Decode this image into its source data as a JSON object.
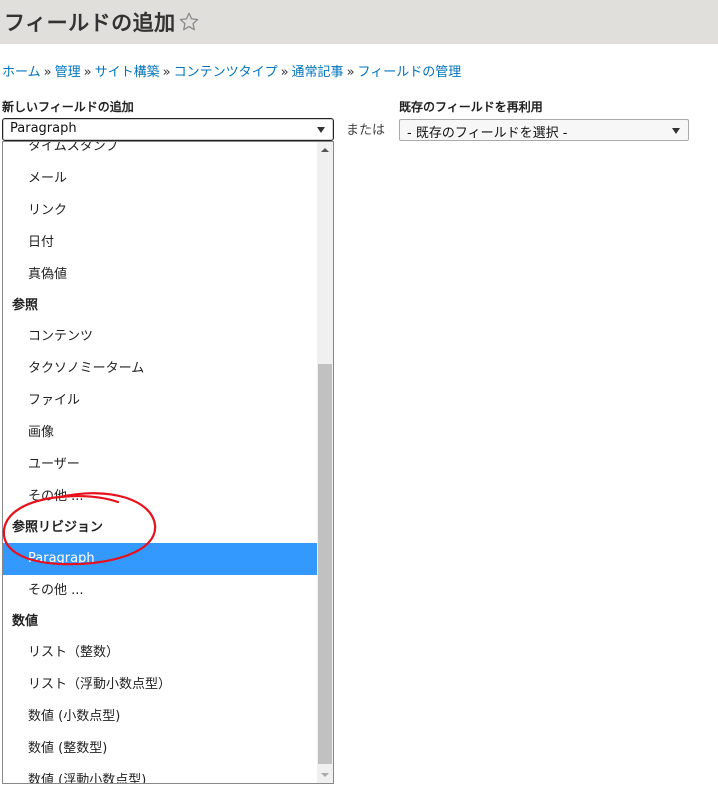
{
  "header": {
    "title": "フィールドの追加",
    "star_icon": "star-outline-icon"
  },
  "breadcrumb": {
    "items": [
      "ホーム",
      "管理",
      "サイト構築",
      "コンテンツタイプ",
      "通常記事",
      "フィールドの管理"
    ],
    "separator": "»"
  },
  "new_field": {
    "label": "新しいフィールドの追加",
    "selected_value": "Paragraph"
  },
  "or_text": "または",
  "existing_field": {
    "label": "既存のフィールドを再利用",
    "selected_value": "- 既存のフィールドを選択 -"
  },
  "dropdown": {
    "items": [
      {
        "type": "option",
        "label": "タイムスタンプ"
      },
      {
        "type": "option",
        "label": "メール"
      },
      {
        "type": "option",
        "label": "リンク"
      },
      {
        "type": "option",
        "label": "日付"
      },
      {
        "type": "option",
        "label": "真偽値"
      },
      {
        "type": "group",
        "label": "参照"
      },
      {
        "type": "option",
        "label": "コンテンツ"
      },
      {
        "type": "option",
        "label": "タクソノミーターム"
      },
      {
        "type": "option",
        "label": "ファイル"
      },
      {
        "type": "option",
        "label": "画像"
      },
      {
        "type": "option",
        "label": "ユーザー"
      },
      {
        "type": "option",
        "label": "その他 ..."
      },
      {
        "type": "group",
        "label": "参照リビジョン"
      },
      {
        "type": "option",
        "label": "Paragraph",
        "selected": true
      },
      {
        "type": "option",
        "label": "その他 ..."
      },
      {
        "type": "group",
        "label": "数値"
      },
      {
        "type": "option",
        "label": "リスト（整数）"
      },
      {
        "type": "option",
        "label": "リスト（浮動小数点型）"
      },
      {
        "type": "option",
        "label": "数値 (小数点型)"
      },
      {
        "type": "option",
        "label": "数値 (整数型)"
      },
      {
        "type": "option",
        "label": "数値 (浮動小数点型)"
      }
    ]
  },
  "colors": {
    "link": "#0074bd",
    "selection": "#3399ff",
    "annotation": "#e8101a",
    "title_bar": "#e0dfdb"
  }
}
